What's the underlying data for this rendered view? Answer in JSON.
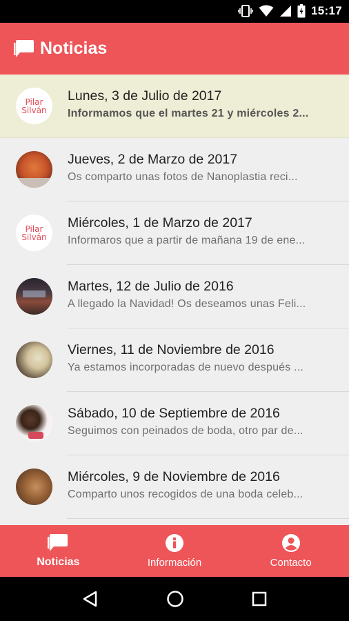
{
  "status_bar": {
    "time": "15:17"
  },
  "app_bar": {
    "title": "Noticias",
    "icon": "chat-icon"
  },
  "logo": {
    "line1": "Pilar",
    "line2": "Silván"
  },
  "news": [
    {
      "title": "Lunes, 3 de Julio de 2017",
      "subtitle": "Informamos que el martes 21 y miércoles 2...",
      "avatar": "logo"
    },
    {
      "title": "Jueves, 2 de Marzo de 2017",
      "subtitle": "Os comparto unas fotos de Nanoplastia reci...",
      "avatar": "photo"
    },
    {
      "title": "Miércoles, 1 de Marzo de 2017",
      "subtitle": "Informaros que a partir de mañana 19 de ene...",
      "avatar": "logo"
    },
    {
      "title": "Martes, 12 de Julio de 2016",
      "subtitle": "A llegado la Navidad! Os deseamos unas Feli...",
      "avatar": "photo"
    },
    {
      "title": "Viernes, 11 de Noviembre de 2016",
      "subtitle": "Ya estamos incorporadas de nuevo después ...",
      "avatar": "photo"
    },
    {
      "title": "Sábado, 10 de Septiembre de 2016",
      "subtitle": "Seguimos con peinados de boda, otro par de...",
      "avatar": "photo"
    },
    {
      "title": "Miércoles, 9 de Noviembre de 2016",
      "subtitle": "Comparto unos recogidos de una boda celeb...",
      "avatar": "photo"
    }
  ],
  "bottom_nav": [
    {
      "label": "Noticias",
      "icon": "chat-icon",
      "active": true
    },
    {
      "label": "Información",
      "icon": "info-icon",
      "active": false
    },
    {
      "label": "Contacto",
      "icon": "account-icon",
      "active": false
    }
  ],
  "colors": {
    "primary": "#ee5559",
    "highlight_row": "#eeeed6",
    "list_bg": "#efefef"
  }
}
